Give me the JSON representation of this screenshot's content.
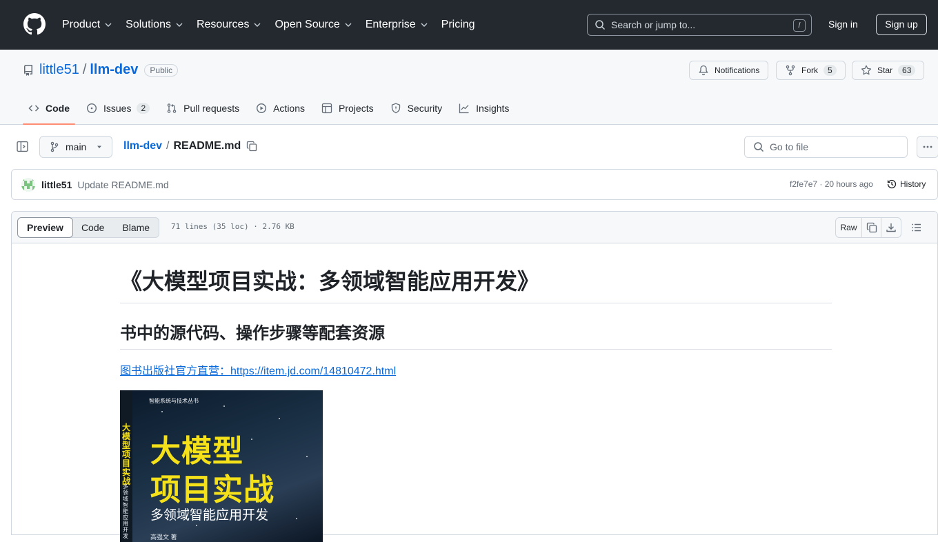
{
  "nav": {
    "items": [
      {
        "label": "Product",
        "has_menu": true
      },
      {
        "label": "Solutions",
        "has_menu": true
      },
      {
        "label": "Resources",
        "has_menu": true
      },
      {
        "label": "Open Source",
        "has_menu": true
      },
      {
        "label": "Enterprise",
        "has_menu": true
      },
      {
        "label": "Pricing",
        "has_menu": false
      }
    ],
    "search_placeholder": "Search or jump to...",
    "search_shortcut": "/",
    "sign_in": "Sign in",
    "sign_up": "Sign up"
  },
  "repo": {
    "owner": "little51",
    "separator": "/",
    "name": "llm-dev",
    "visibility": "Public",
    "notifications_label": "Notifications",
    "fork_label": "Fork",
    "fork_count": "5",
    "star_label": "Star",
    "star_count": "63",
    "tabs": [
      {
        "label": "Code",
        "icon": "code-icon",
        "active": true
      },
      {
        "label": "Issues",
        "icon": "issue-icon",
        "count": "2"
      },
      {
        "label": "Pull requests",
        "icon": "pull-request-icon"
      },
      {
        "label": "Actions",
        "icon": "play-icon"
      },
      {
        "label": "Projects",
        "icon": "table-icon"
      },
      {
        "label": "Security",
        "icon": "shield-icon"
      },
      {
        "label": "Insights",
        "icon": "graph-icon"
      }
    ]
  },
  "file": {
    "branch": "main",
    "breadcrumb_repo": "llm-dev",
    "breadcrumb_sep": "/",
    "filename": "README.md",
    "goto_placeholder": "Go to file"
  },
  "commit": {
    "author": "little51",
    "message": "Update README.md",
    "meta": "f2fe7e7 · 20 hours ago",
    "history_label": "History"
  },
  "viewer": {
    "modes": [
      "Preview",
      "Code",
      "Blame"
    ],
    "active_mode": "Preview",
    "info": "71 lines (35 loc) · 2.76 KB",
    "raw_label": "Raw"
  },
  "readme": {
    "h1": "《大模型项目实战：多领域智能应用开发》",
    "h2": "书中的源代码、操作步骤等配套资源",
    "link_text": "图书出版社官方直营：https://item.jd.com/14810472.html",
    "cover": {
      "series": "智能系统与技术丛书",
      "title_line1": "大模型",
      "title_line2": "项目实战",
      "subtitle": "多领域智能应用开发",
      "spine_title": "大模型项目实战",
      "spine_sub": "多领域智能应用开发",
      "author": "高强文 著"
    }
  },
  "colors": {
    "header_bg": "#24292f",
    "link": "#0969da",
    "active_tab_underline": "#fd8c73",
    "cover_yellow": "#f5e11a"
  }
}
